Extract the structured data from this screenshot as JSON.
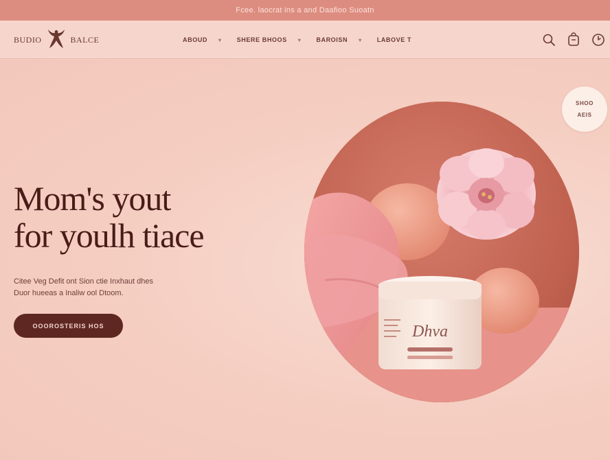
{
  "announcement": "Fcee. laocrat ins a and Daafioo Suoatn",
  "brand": {
    "left": "BUDIO",
    "right": "BALCE"
  },
  "nav": {
    "items": [
      {
        "label": "ABOUD",
        "has_dropdown": true
      },
      {
        "label": "SHERE BHOOS",
        "has_dropdown": true
      },
      {
        "label": "BAROISN",
        "has_dropdown": true
      },
      {
        "label": "LABOVE T",
        "has_dropdown": false
      }
    ]
  },
  "header_icons": [
    "search-icon",
    "cart-icon",
    "account-icon"
  ],
  "badge": {
    "line1": "SHOO",
    "line2": "AEIS"
  },
  "hero": {
    "headline_line1": "Mom's yout",
    "headline_line2": "for youlh tiace",
    "subtext_line1": "Citee Veg Defit ont Sion ctie Inxhaut dhes",
    "subtext_line2": "Duor hueeas a Inaliw ool Dtoom.",
    "cta_label": "OOOROSTERIS HOS"
  },
  "product": {
    "jar_label": "Dhva"
  },
  "colors": {
    "announcement_bar": "#dd8d80",
    "header_bg": "#f6d6cc",
    "page_bg": "#f5cfc3",
    "headline": "#4a1c18",
    "cta_bg": "#5e2722",
    "badge_bg": "#fcefe8"
  }
}
